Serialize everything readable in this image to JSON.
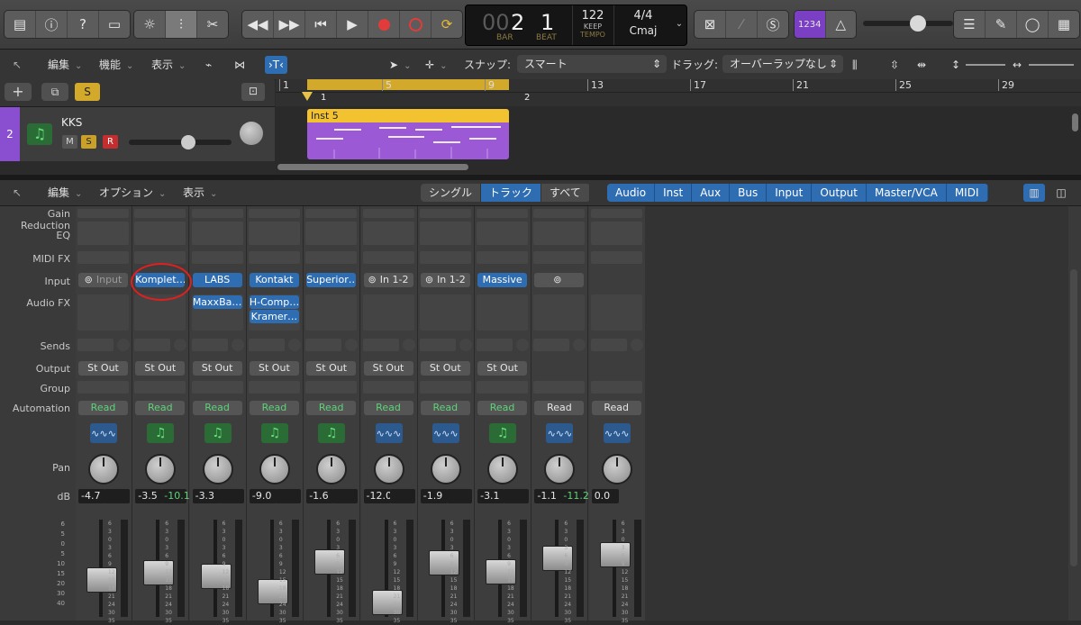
{
  "lcd": {
    "bar": "2",
    "beat": "1",
    "bar_prefix": "00",
    "bar_label": "BAR",
    "beat_label": "BEAT",
    "tempo": "122",
    "tempo_mode": "KEEP",
    "tempo_label": "TEMPO",
    "signature": "4/4",
    "key": "Cmaj"
  },
  "cycle_count": "1234",
  "toolbar2": {
    "edit": "編集",
    "function": "機能",
    "view": "表示",
    "snap_label": "スナップ:",
    "snap_value": "スマート",
    "drag_label": "ドラッグ:",
    "drag_value": "オーバーラップなし"
  },
  "ruler": {
    "marks": [
      "1",
      "5",
      "9",
      "13",
      "17",
      "21",
      "25",
      "29"
    ],
    "locator_start": "1",
    "locator_end": "2"
  },
  "track": {
    "number": "2",
    "name": "KKS",
    "mute": "M",
    "solo": "S",
    "record": "R"
  },
  "region": {
    "name": "Inst 5"
  },
  "mixer_toolbar": {
    "edit": "編集",
    "options": "オプション",
    "view": "表示",
    "modes": [
      "シングル",
      "トラック",
      "すべて"
    ],
    "filters": [
      "Audio",
      "Inst",
      "Aux",
      "Bus",
      "Input",
      "Output",
      "Master/VCA",
      "MIDI"
    ]
  },
  "row_labels": {
    "gain": "Gain Reduction",
    "eq": "EQ",
    "midifx": "MIDI FX",
    "input": "Input",
    "audiofx": "Audio FX",
    "sends": "Sends",
    "output": "Output",
    "group": "Group",
    "automation": "Automation",
    "pan": "Pan",
    "db": "dB"
  },
  "fader_scale": [
    "6",
    "3",
    "0",
    "3",
    "6",
    "9",
    "12",
    "15",
    "18",
    "21",
    "24",
    "30",
    "35"
  ],
  "fader_scale_left": [
    "6",
    "5",
    "0",
    "5",
    "10",
    "15",
    "20",
    "30",
    "40"
  ],
  "strips": [
    {
      "input": "Input",
      "input_style": "link",
      "fx": [],
      "output": "St Out",
      "automation": "Read",
      "type": "audio",
      "db": "-4.7",
      "peak": "",
      "fader": 0.35
    },
    {
      "input": "Komplet…",
      "input_style": "blue",
      "fx": [],
      "output": "St Out",
      "automation": "Read",
      "type": "inst",
      "db": "-3.5",
      "peak": "-10.1",
      "fader": 0.45
    },
    {
      "input": "LABS",
      "input_style": "blue",
      "fx": [
        "MaxxBa…"
      ],
      "output": "St Out",
      "automation": "Read",
      "type": "inst",
      "db": "-3.3",
      "peak": "",
      "fader": 0.4
    },
    {
      "input": "Kontakt",
      "input_style": "blue",
      "fx": [
        "H-Comp…",
        "Kramer…"
      ],
      "output": "St Out",
      "automation": "Read",
      "type": "inst",
      "db": "-9.0",
      "peak": "",
      "fader": 0.2
    },
    {
      "input": "Superior…",
      "input_style": "blue",
      "fx": [],
      "output": "St Out",
      "automation": "Read",
      "type": "inst",
      "db": "-1.6",
      "peak": "",
      "fader": 0.6
    },
    {
      "input": "In 1-2",
      "input_style": "link",
      "fx": [],
      "output": "St Out",
      "automation": "Read",
      "type": "audio",
      "db": "-12.0",
      "peak": "",
      "fader": 0.05
    },
    {
      "input": "In 1-2",
      "input_style": "link",
      "fx": [],
      "output": "St Out",
      "automation": "Read",
      "type": "audio",
      "db": "-1.9",
      "peak": "",
      "fader": 0.58
    },
    {
      "input": "Massive",
      "input_style": "blue",
      "fx": [],
      "output": "St Out",
      "automation": "Read",
      "type": "inst",
      "db": "-3.1",
      "peak": "",
      "fader": 0.46
    },
    {
      "input": "",
      "input_style": "link",
      "fx": [],
      "output": "",
      "automation": "Read",
      "type": "audio",
      "db": "-1.1",
      "peak": "-11.2",
      "fader": 0.65
    },
    {
      "input": "",
      "input_style": "none",
      "fx": [],
      "output": "",
      "automation": "Read",
      "type": "audio",
      "db": "0.0",
      "peak": "",
      "fader": 0.7
    }
  ],
  "colors": {
    "accent_blue": "#2f6db3",
    "region_yellow": "#f2c230",
    "region_purple": "#9b59d6",
    "record_red": "#e23b3b",
    "read_green": "#5fd27a"
  }
}
